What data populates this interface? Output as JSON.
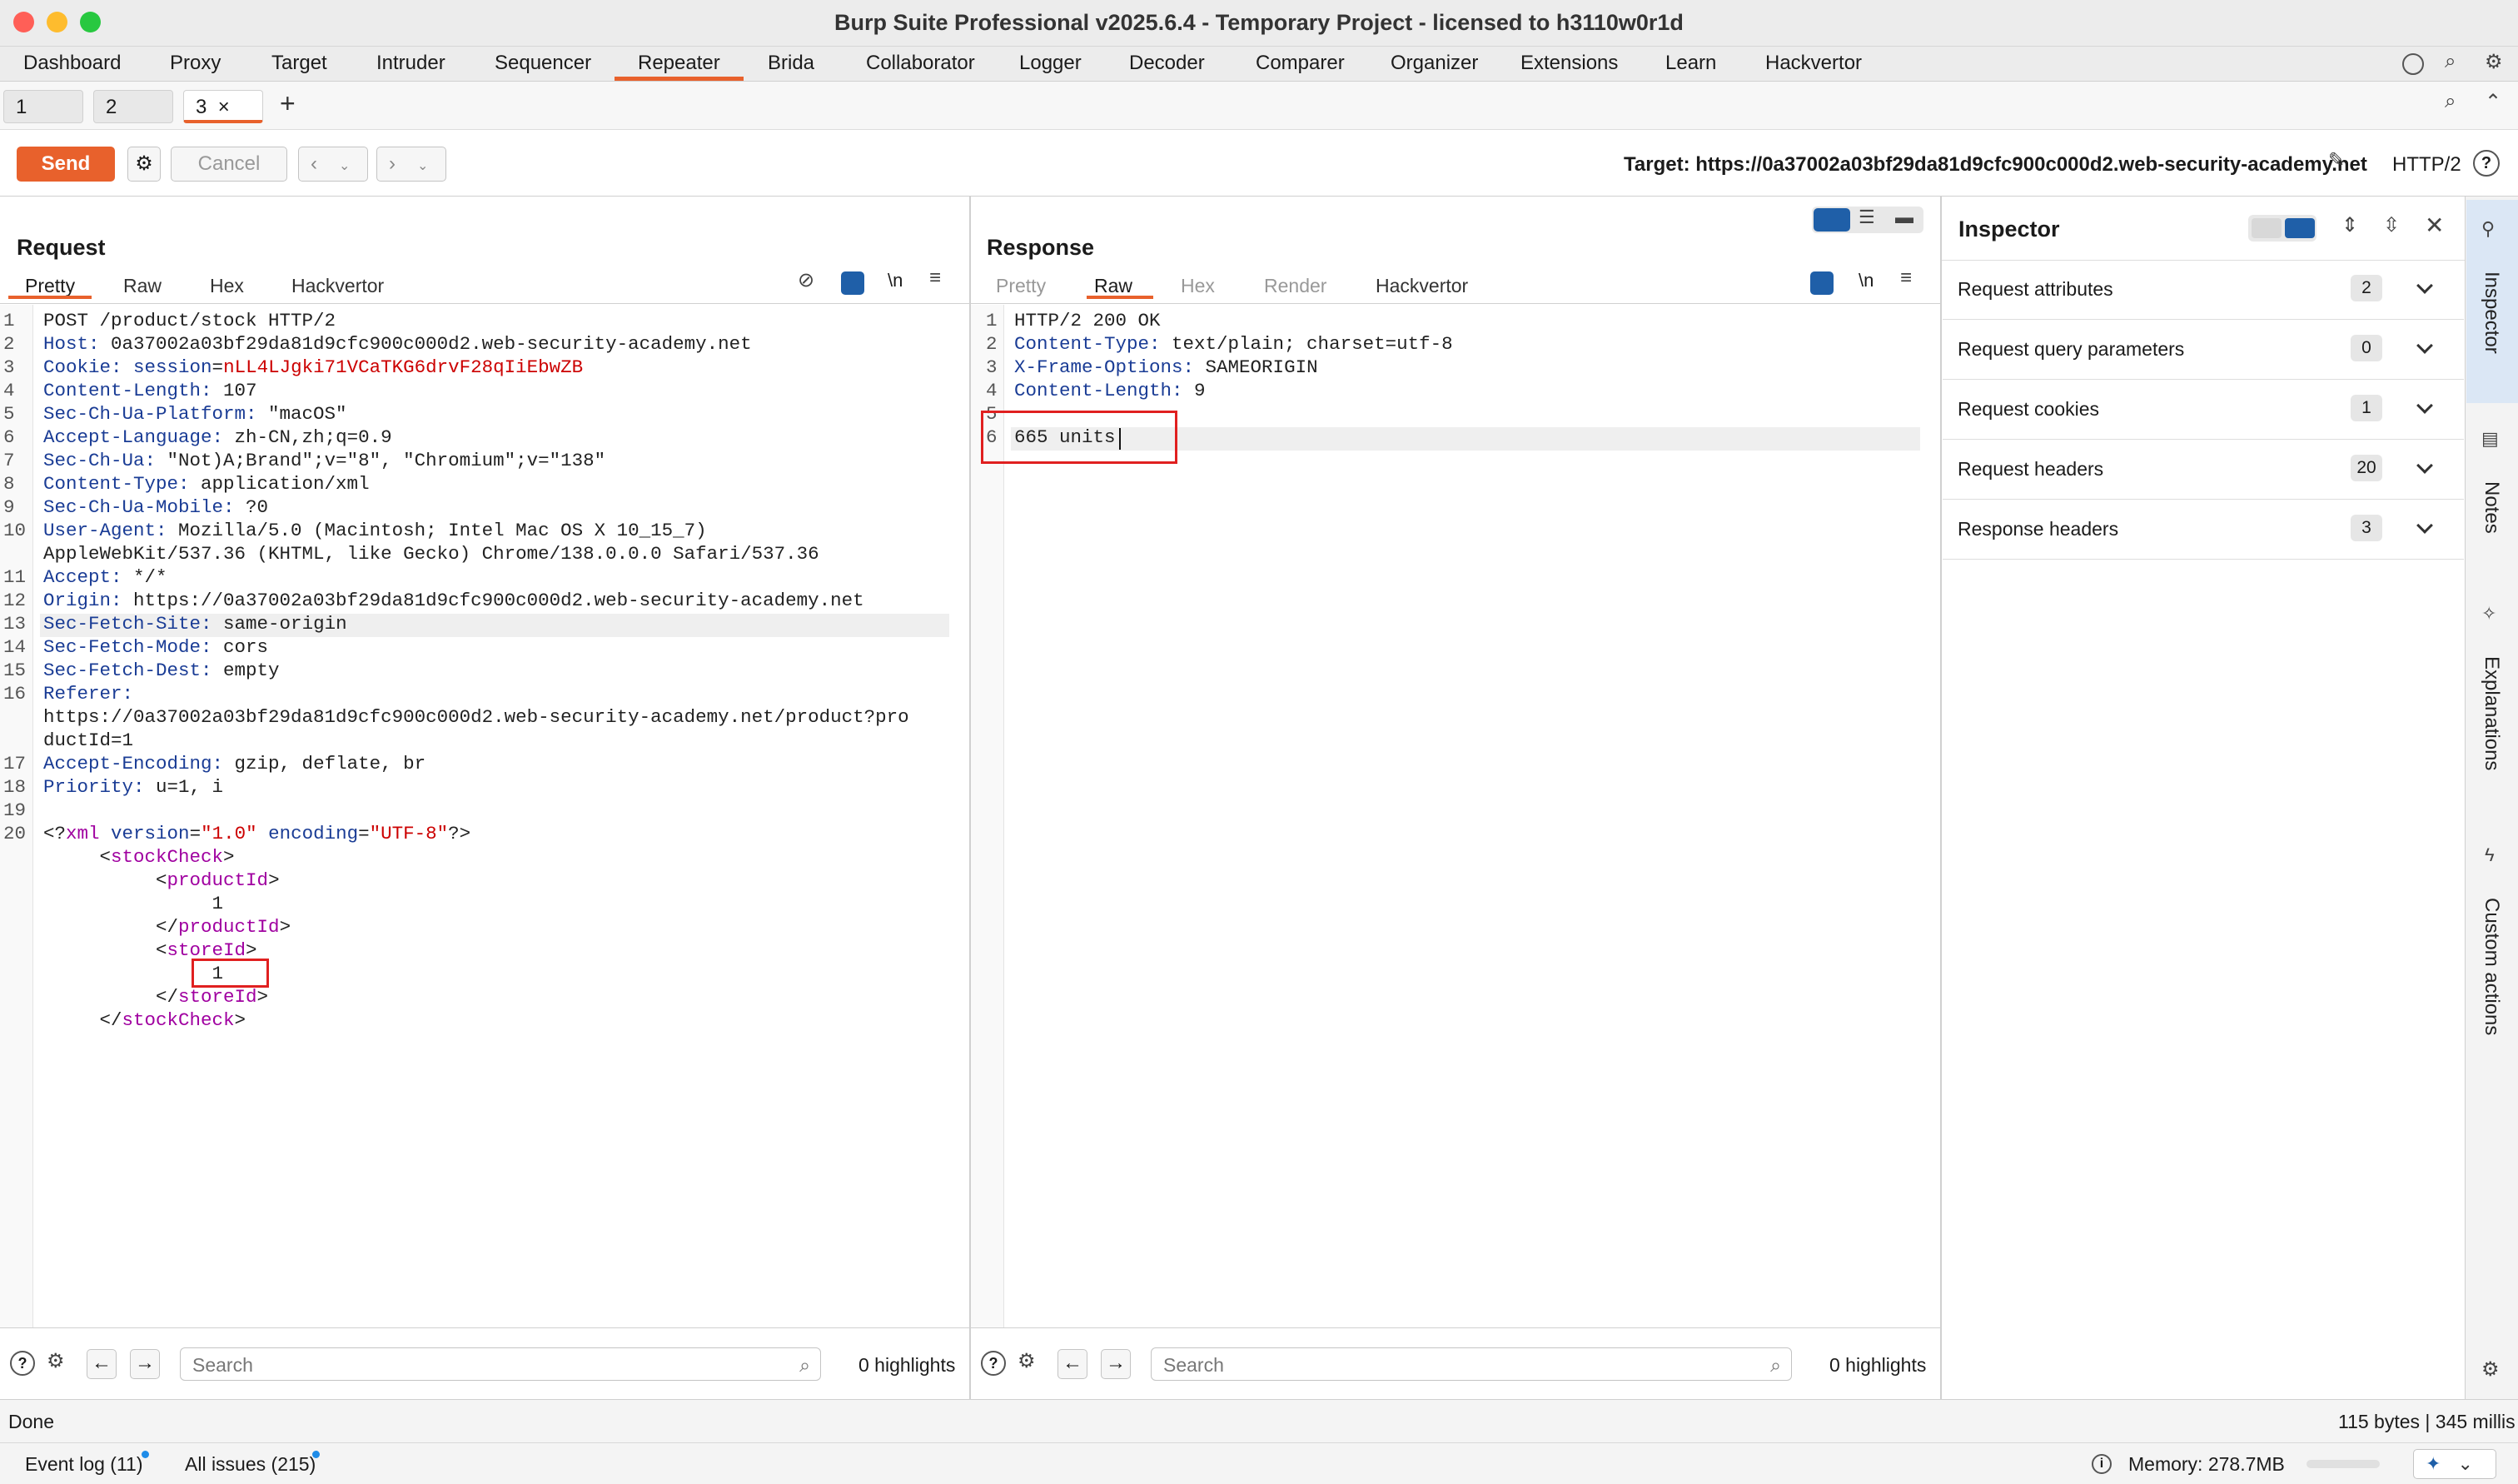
{
  "window": {
    "title": "Burp Suite Professional v2025.6.4 - Temporary Project - licensed to h3110w0r1d"
  },
  "menu": {
    "items": [
      "Dashboard",
      "Proxy",
      "Target",
      "Intruder",
      "Sequencer",
      "Repeater",
      "Brida",
      "Collaborator",
      "Logger",
      "Decoder",
      "Comparer",
      "Organizer",
      "Extensions",
      "Learn",
      "Hackvertor"
    ],
    "active": "Repeater"
  },
  "repeater_tabs": {
    "items": [
      "1",
      "2",
      "3"
    ],
    "active": "3",
    "close": "×",
    "add": "+"
  },
  "toolbar": {
    "send": "Send",
    "cancel": "Cancel",
    "target": "Target: https://0a37002a03bf29da81d9cfc900c000d2.web-security-academy.net",
    "protocol": "HTTP/2"
  },
  "request": {
    "title": "Request",
    "tabs": [
      "Pretty",
      "Raw",
      "Hex",
      "Hackvertor"
    ],
    "active_tab": "Pretty",
    "newline_label": "\\n",
    "lines": [
      {
        "n": "1",
        "parts": [
          [
            "",
            "POST /product/stock HTTP/2"
          ]
        ]
      },
      {
        "n": "2",
        "parts": [
          [
            "k",
            "Host:"
          ],
          [
            "",
            " 0a37002a03bf29da81d9cfc900c000d2.web-security-academy.net"
          ]
        ]
      },
      {
        "n": "3",
        "parts": [
          [
            "k",
            "Cookie:"
          ],
          [
            "",
            " "
          ],
          [
            "k",
            "session"
          ],
          [
            "",
            "="
          ],
          [
            "v",
            "nLL4LJgki71VCaTKG6drvF28qIiEbwZB"
          ]
        ]
      },
      {
        "n": "4",
        "parts": [
          [
            "k",
            "Content-Length:"
          ],
          [
            "",
            " 107"
          ]
        ]
      },
      {
        "n": "5",
        "parts": [
          [
            "k",
            "Sec-Ch-Ua-Platform:"
          ],
          [
            "",
            " \"macOS\""
          ]
        ]
      },
      {
        "n": "6",
        "parts": [
          [
            "k",
            "Accept-Language:"
          ],
          [
            "",
            " zh-CN,zh;q=0.9"
          ]
        ]
      },
      {
        "n": "7",
        "parts": [
          [
            "k",
            "Sec-Ch-Ua:"
          ],
          [
            "",
            " \"Not)A;Brand\";v=\"8\", \"Chromium\";v=\"138\""
          ]
        ]
      },
      {
        "n": "8",
        "parts": [
          [
            "k",
            "Content-Type:"
          ],
          [
            "",
            " application/xml"
          ]
        ]
      },
      {
        "n": "9",
        "parts": [
          [
            "k",
            "Sec-Ch-Ua-Mobile:"
          ],
          [
            "",
            " ?0"
          ]
        ]
      },
      {
        "n": "10",
        "parts": [
          [
            "k",
            "User-Agent:"
          ],
          [
            "",
            " Mozilla/5.0 (Macintosh; Intel Mac OS X 10_15_7)"
          ]
        ]
      },
      {
        "n": "",
        "parts": [
          [
            "",
            "AppleWebKit/537.36 (KHTML, like Gecko) Chrome/138.0.0.0 Safari/537.36"
          ]
        ]
      },
      {
        "n": "11",
        "parts": [
          [
            "k",
            "Accept:"
          ],
          [
            "",
            " */*"
          ]
        ]
      },
      {
        "n": "12",
        "parts": [
          [
            "k",
            "Origin:"
          ],
          [
            "",
            " https://0a37002a03bf29da81d9cfc900c000d2.web-security-academy.net"
          ]
        ]
      },
      {
        "n": "13",
        "parts": [
          [
            "k",
            "Sec-Fetch-Site:"
          ],
          [
            "",
            " same-origin"
          ]
        ],
        "highlight": true
      },
      {
        "n": "14",
        "parts": [
          [
            "k",
            "Sec-Fetch-Mode:"
          ],
          [
            "",
            " cors"
          ]
        ]
      },
      {
        "n": "15",
        "parts": [
          [
            "k",
            "Sec-Fetch-Dest:"
          ],
          [
            "",
            " empty"
          ]
        ]
      },
      {
        "n": "16",
        "parts": [
          [
            "k",
            "Referer:"
          ]
        ]
      },
      {
        "n": "",
        "parts": [
          [
            "",
            "https://0a37002a03bf29da81d9cfc900c000d2.web-security-academy.net/product?pro"
          ]
        ]
      },
      {
        "n": "",
        "parts": [
          [
            "",
            "ductId=1"
          ]
        ]
      },
      {
        "n": "17",
        "parts": [
          [
            "k",
            "Accept-Encoding:"
          ],
          [
            "",
            " gzip, deflate, br"
          ]
        ]
      },
      {
        "n": "18",
        "parts": [
          [
            "k",
            "Priority:"
          ],
          [
            "",
            " u=1, i"
          ]
        ]
      },
      {
        "n": "19",
        "parts": []
      },
      {
        "n": "20",
        "parts": [
          [
            "",
            "<?"
          ],
          [
            "tag",
            "xml"
          ],
          [
            "",
            " "
          ],
          [
            "k",
            "version"
          ],
          [
            "",
            "="
          ],
          [
            "str",
            "\"1.0\""
          ],
          [
            "",
            " "
          ],
          [
            "k",
            "encoding"
          ],
          [
            "",
            "="
          ],
          [
            "str",
            "\"UTF-8\""
          ],
          [
            "",
            "?>"
          ]
        ]
      },
      {
        "n": "",
        "parts": [
          [
            "",
            "     <"
          ],
          [
            "tag",
            "stockCheck"
          ],
          [
            "",
            ">"
          ]
        ]
      },
      {
        "n": "",
        "parts": [
          [
            "",
            "          <"
          ],
          [
            "tag",
            "productId"
          ],
          [
            "",
            ">"
          ]
        ]
      },
      {
        "n": "",
        "parts": [
          [
            "",
            "               1"
          ]
        ]
      },
      {
        "n": "",
        "parts": [
          [
            "",
            "          </"
          ],
          [
            "tag",
            "productId"
          ],
          [
            "",
            ">"
          ]
        ]
      },
      {
        "n": "",
        "parts": [
          [
            "",
            "          <"
          ],
          [
            "tag",
            "storeId"
          ],
          [
            "",
            ">"
          ]
        ]
      },
      {
        "n": "",
        "parts": [
          [
            "",
            "               1"
          ]
        ]
      },
      {
        "n": "",
        "parts": [
          [
            "",
            "          </"
          ],
          [
            "tag",
            "storeId"
          ],
          [
            "",
            ">"
          ]
        ]
      },
      {
        "n": "",
        "parts": [
          [
            "",
            "     </"
          ],
          [
            "tag",
            "stockCheck"
          ],
          [
            "",
            ">"
          ]
        ]
      }
    ],
    "search_placeholder": "Search",
    "highlights": "0 highlights"
  },
  "response": {
    "title": "Response",
    "tabs": [
      "Pretty",
      "Raw",
      "Hex",
      "Render",
      "Hackvertor"
    ],
    "active_tab": "Raw",
    "newline_label": "\\n",
    "lines": [
      {
        "n": "1",
        "parts": [
          [
            "",
            "HTTP/2 200 OK"
          ]
        ]
      },
      {
        "n": "2",
        "parts": [
          [
            "k",
            "Content-Type:"
          ],
          [
            "",
            " text/plain; charset=utf-8"
          ]
        ]
      },
      {
        "n": "3",
        "parts": [
          [
            "k",
            "X-Frame-Options:"
          ],
          [
            "",
            " SAMEORIGIN"
          ]
        ]
      },
      {
        "n": "4",
        "parts": [
          [
            "k",
            "Content-Length:"
          ],
          [
            "",
            " 9"
          ]
        ]
      },
      {
        "n": "5",
        "parts": []
      },
      {
        "n": "6",
        "parts": [
          [
            "",
            "665 units"
          ]
        ],
        "highlight": true
      }
    ],
    "search_placeholder": "Search",
    "highlights": "0 highlights"
  },
  "inspector": {
    "title": "Inspector",
    "rows": [
      {
        "label": "Request attributes",
        "count": "2"
      },
      {
        "label": "Request query parameters",
        "count": "0"
      },
      {
        "label": "Request cookies",
        "count": "1"
      },
      {
        "label": "Request headers",
        "count": "20"
      },
      {
        "label": "Response headers",
        "count": "3"
      }
    ]
  },
  "sidebar": {
    "items": [
      "Inspector",
      "Notes",
      "Explanations",
      "Custom actions"
    ]
  },
  "status": {
    "left": "Done",
    "right": "115 bytes | 345 millis"
  },
  "footer": {
    "event_log": "Event log (11)",
    "issues": "All issues (215)",
    "memory": "Memory: 278.7MB"
  },
  "colors": {
    "accent": "#e8612c",
    "blue": "#1f5fa8",
    "highlight_box": "#e02020"
  }
}
